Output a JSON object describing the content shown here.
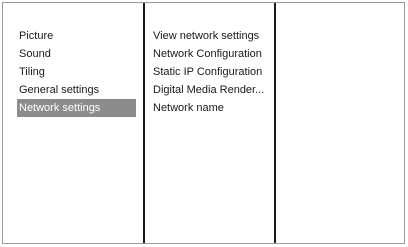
{
  "main_menu": {
    "items": [
      {
        "label": "Picture"
      },
      {
        "label": "Sound"
      },
      {
        "label": "Tiling"
      },
      {
        "label": "General settings"
      },
      {
        "label": "Network settings",
        "selected": true
      }
    ]
  },
  "sub_menu": {
    "items": [
      {
        "label": "View network settings"
      },
      {
        "label": "Network Configuration"
      },
      {
        "label": "Static IP Configuration"
      },
      {
        "label": "Digital Media Render..."
      },
      {
        "label": "Network name"
      }
    ]
  },
  "colors": {
    "selected_background": "#8c8c8c",
    "selected_text": "#ffffff",
    "divider": "#1a1a1a"
  }
}
